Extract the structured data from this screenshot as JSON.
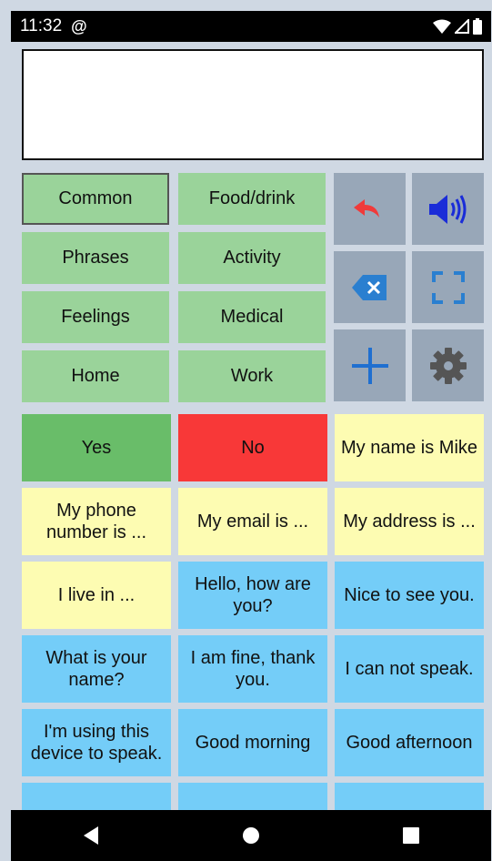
{
  "status": {
    "time": "11:32"
  },
  "categories": [
    {
      "label": "Common",
      "selected": true
    },
    {
      "label": "Food/drink"
    },
    {
      "label": "Phrases"
    },
    {
      "label": "Activity"
    },
    {
      "label": "Feelings"
    },
    {
      "label": "Medical"
    },
    {
      "label": "Home"
    },
    {
      "label": "Work"
    }
  ],
  "controls": [
    {
      "icon": "undo-icon"
    },
    {
      "icon": "speaker-icon"
    },
    {
      "icon": "backspace-icon"
    },
    {
      "icon": "fullscreen-icon"
    },
    {
      "icon": "add-icon"
    },
    {
      "icon": "settings-gear-icon"
    }
  ],
  "tiles": [
    {
      "text": "Yes",
      "color": "#69bd69"
    },
    {
      "text": "No",
      "color": "#f83838"
    },
    {
      "text": "My name is Mike",
      "color": "#fdfcb2"
    },
    {
      "text": "My phone number is ...",
      "color": "#fdfcb2"
    },
    {
      "text": "My email is ...",
      "color": "#fdfcb2"
    },
    {
      "text": "My address is ...",
      "color": "#fdfcb2"
    },
    {
      "text": "I live in ...",
      "color": "#fdfcb2"
    },
    {
      "text": "Hello, how are you?",
      "color": "#74cdf8"
    },
    {
      "text": "Nice to see you.",
      "color": "#74cdf8"
    },
    {
      "text": "What is your name?",
      "color": "#74cdf8"
    },
    {
      "text": "I am fine, thank you.",
      "color": "#74cdf8"
    },
    {
      "text": "I can not speak.",
      "color": "#74cdf8"
    },
    {
      "text": "I'm using this device to speak.",
      "color": "#74cdf8"
    },
    {
      "text": "Good morning",
      "color": "#74cdf8"
    },
    {
      "text": "Good afternoon",
      "color": "#74cdf8"
    }
  ]
}
